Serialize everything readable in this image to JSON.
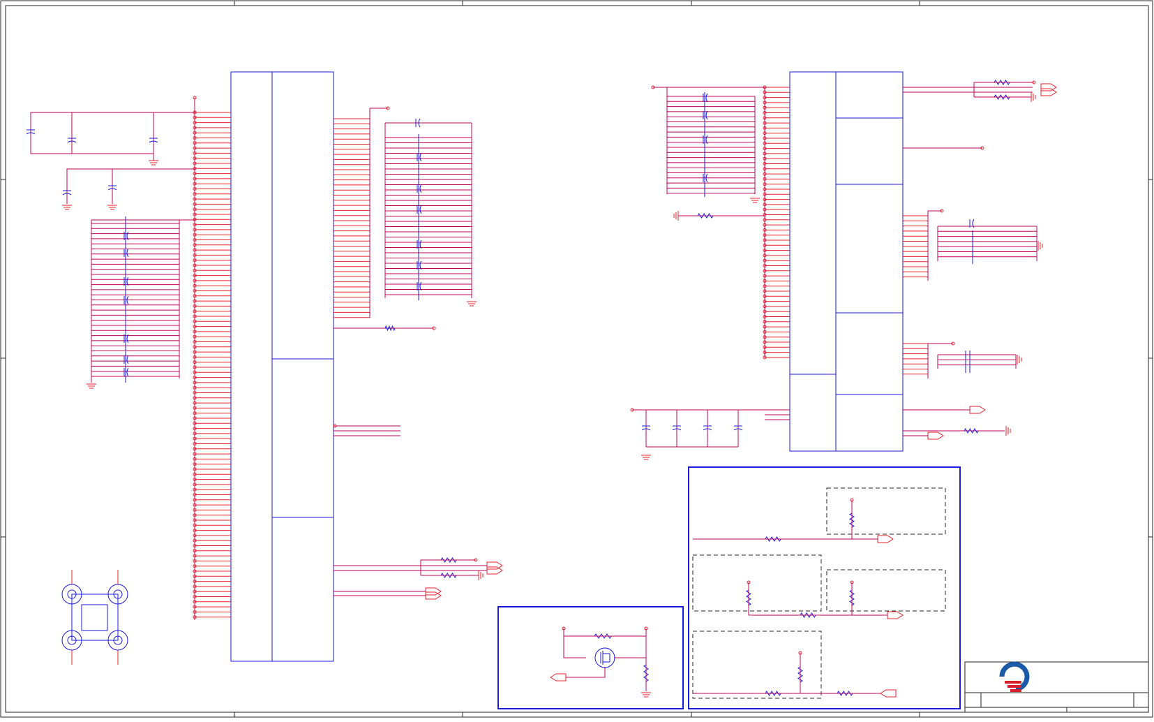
{
  "sheet": {
    "frame_color": "#222222",
    "wire_color": "#c0005a",
    "pin_color": "#e8202a",
    "symbol_color": "#1a1ae0"
  },
  "title_block": {
    "logo": "q-logo-icon",
    "logo_colors": [
      "#1a5aa8",
      "#d8202a"
    ]
  }
}
